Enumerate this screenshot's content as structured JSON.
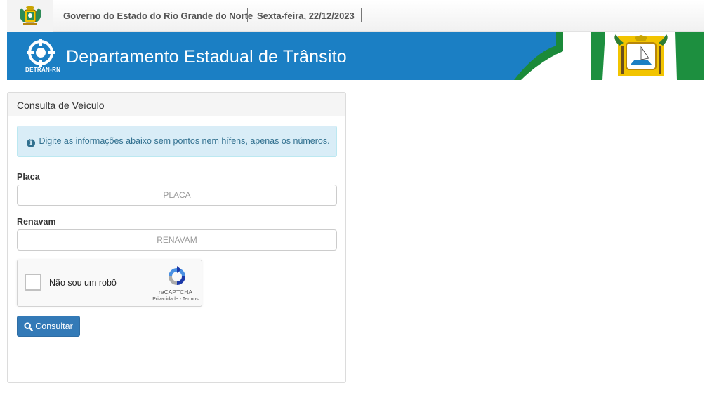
{
  "header": {
    "government": "Governo do Estado do Rio Grande do Norte",
    "date": "Sexta-feira, 22/12/2023"
  },
  "banner": {
    "title": "Departamento Estadual de Trânsito",
    "logo_text": "DETRAN-RN"
  },
  "panel": {
    "title": "Consulta de Veículo",
    "info_message": "Digite as informações abaixo sem pontos nem hífens, apenas os números.",
    "placa_label": "Placa",
    "placa_placeholder": "PLACA",
    "renavam_label": "Renavam",
    "renavam_placeholder": "RENAVAM",
    "captcha": {
      "label": "Não sou um robô",
      "brand": "reCAPTCHA",
      "links": "Privacidade - Termos"
    },
    "submit_label": "Consultar"
  },
  "colors": {
    "banner_blue": "#1b7fc4",
    "button_blue": "#337ab7",
    "alert_bg": "#d9edf7",
    "alert_text": "#31708f"
  }
}
